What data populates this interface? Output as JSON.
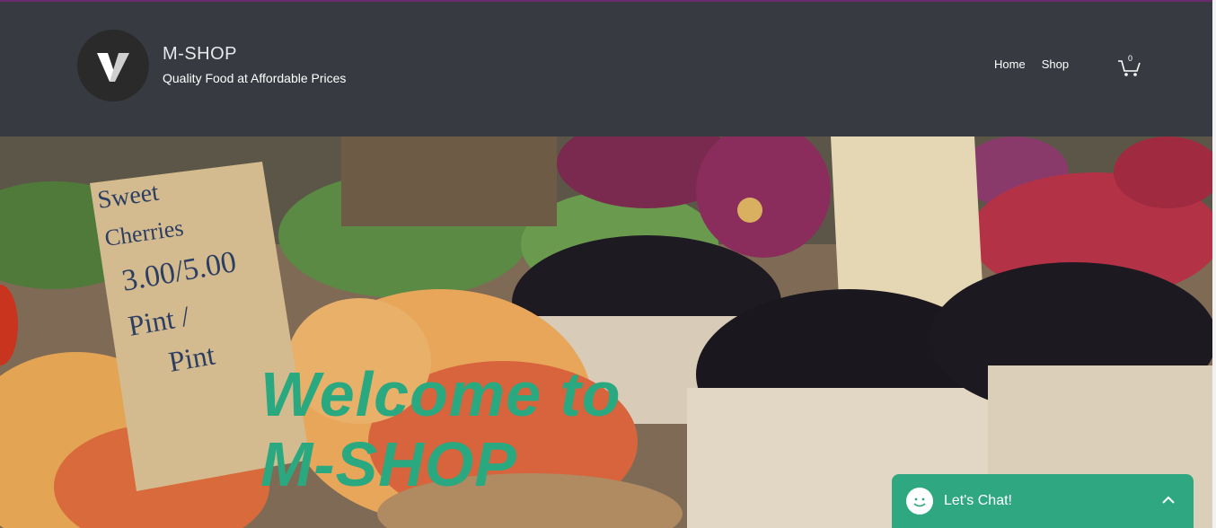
{
  "header": {
    "brand_name": "M-SHOP",
    "tagline": "Quality Food at Affordable Prices",
    "nav": [
      {
        "label": "Home"
      },
      {
        "label": "Shop"
      }
    ],
    "cart_count": "0",
    "logo_icon": "v-logo-icon",
    "cart_icon": "shopping-cart-icon"
  },
  "hero": {
    "title_line1": "Welcome to",
    "title_line2": "M-SHOP",
    "title_color": "#2aa880",
    "image": "market-produce-photo",
    "sign_text": [
      "Sweet",
      "Cherries",
      "3.00/5.00",
      "Pint / Pint"
    ]
  },
  "chat": {
    "label": "Let's Chat!",
    "icon": "smiley-icon",
    "toggle_icon": "chevron-up-icon",
    "color": "#2fa882"
  },
  "colors": {
    "header_bg": "#373a41",
    "accent_line": "#6b2a6e"
  }
}
